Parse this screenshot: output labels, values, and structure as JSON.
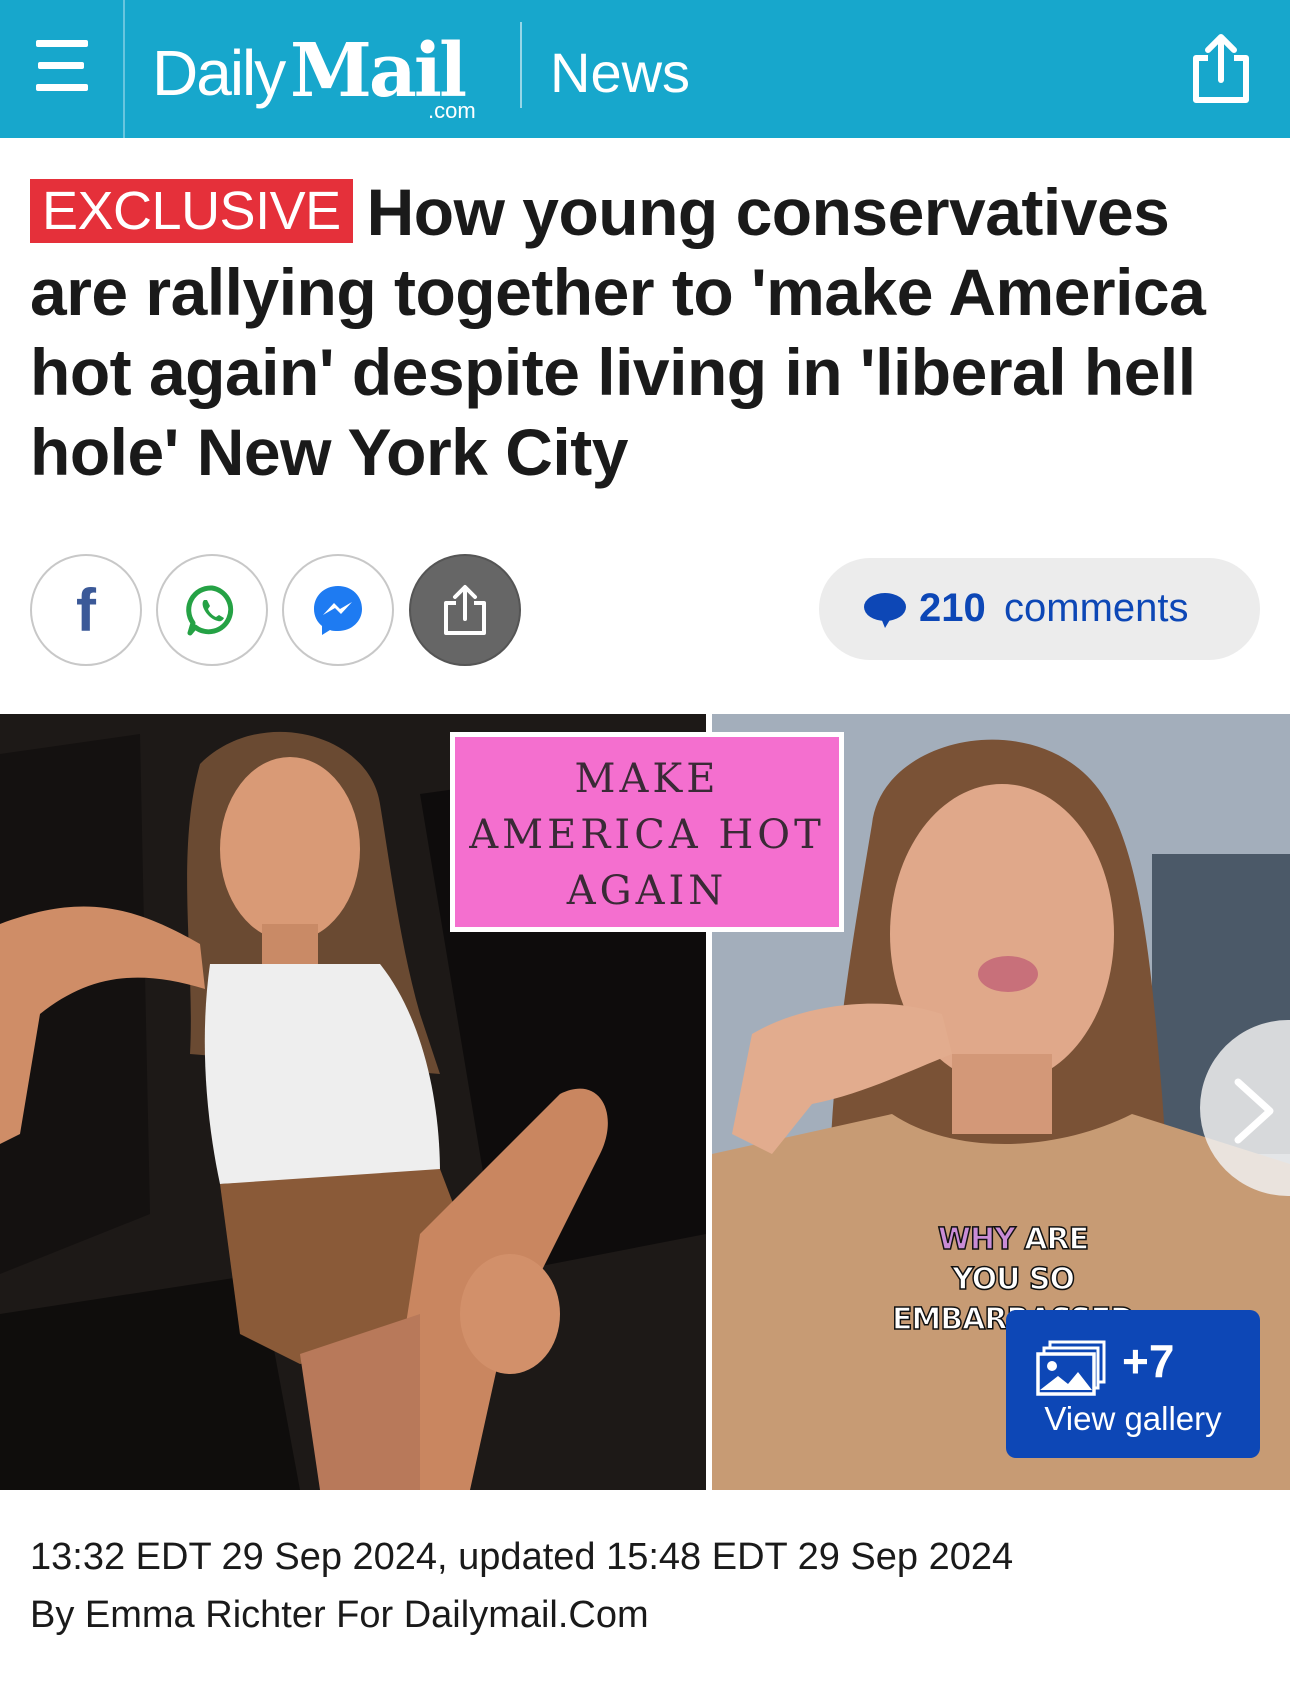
{
  "header": {
    "brand_daily": "Daily",
    "brand_mail": "Mail",
    "brand_com": ".com",
    "section": "News",
    "bg_color": "#17a7cc"
  },
  "article": {
    "tag": "EXCLUSIVE",
    "headline": "How young conservatives are rallying together to 'make America hot again' despite living in 'liberal hell hole' New York City",
    "comments_count": "210",
    "comments_label": "comments",
    "dateline": "13:32 EDT 29 Sep 2024, updated 15:48 EDT 29 Sep 2024",
    "byline": "By Emma Richter For Dailymail.Com"
  },
  "share": {
    "icons": [
      "facebook-icon",
      "whatsapp-icon",
      "messenger-icon",
      "share-icon"
    ]
  },
  "image": {
    "sign_line1": "MAKE",
    "sign_line2": "AMERICA HOT",
    "sign_line3": "AGAIN",
    "caption_why": "WHY",
    "caption_are": "ARE",
    "caption_line2": "YOU SO EMBARRASSED",
    "gallery_count": "+7",
    "gallery_label": "View gallery"
  },
  "colors": {
    "exclusive": "#e5303a",
    "link_blue": "#0d47b6",
    "sign_pink": "#f46fcf"
  }
}
